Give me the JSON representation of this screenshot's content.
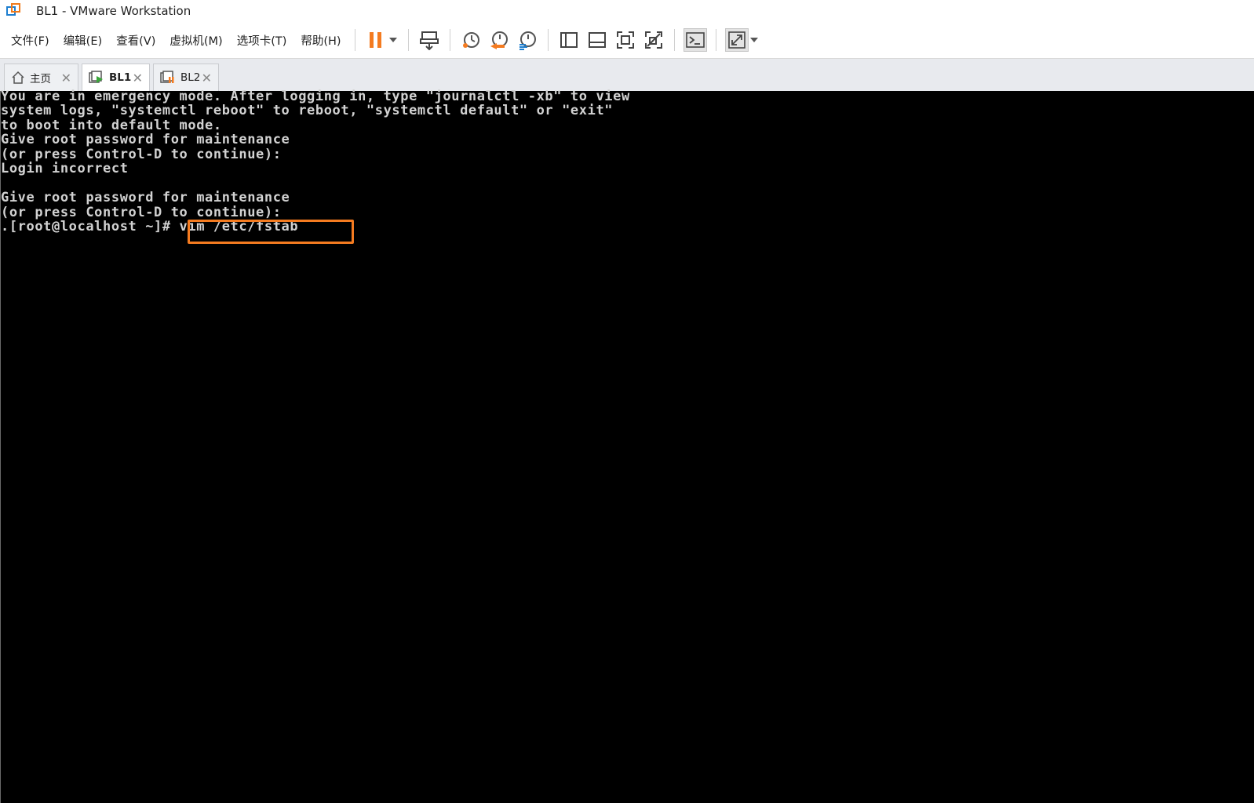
{
  "window": {
    "title": "BL1 - VMware Workstation"
  },
  "menu": {
    "items": [
      "文件(F)",
      "编辑(E)",
      "查看(V)",
      "虚拟机(M)",
      "选项卡(T)",
      "帮助(H)"
    ]
  },
  "tabs": [
    {
      "label": "主页",
      "icon": "home-icon"
    },
    {
      "label": "BL1",
      "icon": "vm-running-icon",
      "active": true
    },
    {
      "label": "BL2",
      "icon": "vm-paused-icon"
    }
  ],
  "console": {
    "lines": [
      "You are in emergency mode. After logging in, type \"journalctl -xb\" to view",
      "system logs, \"systemctl reboot\" to reboot, \"systemctl default\" or \"exit\"",
      "to boot into default mode.",
      "Give root password for maintenance",
      "(or press Control-D to continue):",
      "Login incorrect",
      "",
      "Give root password for maintenance",
      "(or press Control-D to continue):",
      ".[root@localhost ~]# vim /etc/fstab"
    ]
  },
  "colors": {
    "accent_orange": "#f47b20",
    "vmware_blue": "#1e7fd0",
    "console_bg": "#000000",
    "console_text": "#d2d2d2"
  }
}
